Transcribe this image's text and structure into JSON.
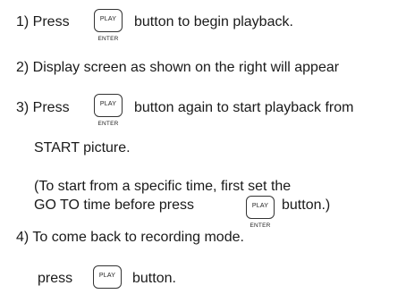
{
  "step1": {
    "prefix": "1) Press",
    "button_label": "PLAY",
    "button_sublabel": "ENTER",
    "suffix": "button to begin playback."
  },
  "step2": {
    "text": "2) Display screen as shown on the right will appear"
  },
  "step3": {
    "prefix": "3) Press",
    "button_label": "PLAY",
    "button_sublabel": "ENTER",
    "suffix": "button again to start playback from",
    "continuation": "START picture."
  },
  "note": {
    "line1": "(To start from a specific time, first set the",
    "line2_prefix": "GO TO time before press",
    "button_label": "PLAY",
    "button_sublabel": "ENTER",
    "line2_suffix": "button.)"
  },
  "step4": {
    "text": "4) To come back to recording mode.",
    "sub_prefix": "press",
    "button_label": "PLAY",
    "sub_suffix": "button."
  }
}
